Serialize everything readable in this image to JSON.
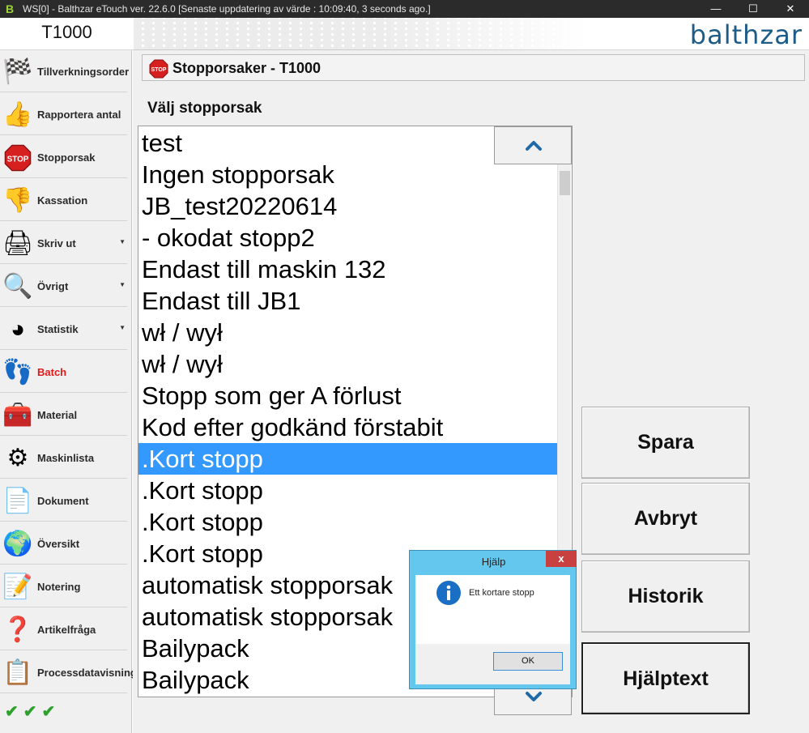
{
  "window": {
    "title": "WS[0] - Balthzar eTouch ver. 22.6.0  [Senaste uppdatering av värde : 10:09:40, 3 seconds ago.]",
    "app_icon_glyph": "B",
    "controls": {
      "minimize": "—",
      "maximize": "☐",
      "close": "✕"
    }
  },
  "header": {
    "machine": "T1000",
    "logo": "balthzar",
    "logo_color": "#1e5c88"
  },
  "sidebar": {
    "items": [
      {
        "label": "Tillverkningsorder",
        "icon": "checkered-flag-icon",
        "glyph": "🏁"
      },
      {
        "label": "Rapportera antal",
        "icon": "thumbs-up-icon",
        "glyph": "👍"
      },
      {
        "label": "Stopporsak",
        "icon": "stop-sign-icon",
        "glyph": "STOP"
      },
      {
        "label": "Kassation",
        "icon": "thumbs-down-icon",
        "glyph": "👎"
      },
      {
        "label": "Skriv ut",
        "icon": "printer-icon",
        "glyph": "🖨",
        "has_submenu": true
      },
      {
        "label": "Övrigt",
        "icon": "magnifier-icon",
        "glyph": "🔍",
        "has_submenu": true
      },
      {
        "label": "Statistik",
        "icon": "pie-chart-icon",
        "glyph": "◕",
        "has_submenu": true
      },
      {
        "label": "Batch",
        "icon": "footprints-icon",
        "glyph": "👣",
        "active": true
      },
      {
        "label": "Material",
        "icon": "toolbox-icon",
        "glyph": "🧰"
      },
      {
        "label": "Maskinlista",
        "icon": "gears-icon",
        "glyph": "⚙"
      },
      {
        "label": "Dokument",
        "icon": "document-icon",
        "glyph": "📄"
      },
      {
        "label": "Översikt",
        "icon": "globe-icon",
        "glyph": "🌍"
      },
      {
        "label": "Notering",
        "icon": "notepad-pencil-icon",
        "glyph": "📝"
      },
      {
        "label": "Artikelfråga",
        "icon": "question-icon",
        "glyph": "❓"
      },
      {
        "label": "Processdatavisning",
        "icon": "data-sheet-icon",
        "glyph": "📋"
      }
    ],
    "submenu_arrow": "▼",
    "status_checks": "✔✔✔",
    "active_color": "#e01a1a"
  },
  "panel": {
    "title": "Stopporsaker - T1000",
    "stop_icon_text": "STOP",
    "choose_label": "Välj stopporsak"
  },
  "reasons": {
    "selected_index": 10,
    "items": [
      "test",
      "Ingen stopporsak",
      "JB_test20220614",
      "- okodat stopp2",
      "Endast till maskin 132",
      "Endast till JB1",
      "wł / wył",
      "wł / wył",
      "Stopp som ger A förlust",
      "Kod efter godkänd förstabit",
      ".Kort stopp",
      ".Kort stopp",
      ".Kort stopp",
      ".Kort stopp",
      "automatisk stopporsak",
      "automatisk stopporsak",
      "Bailypack",
      "Bailypack"
    ],
    "selection_color": "#3399ff"
  },
  "actions": {
    "save": "Spara",
    "cancel": "Avbryt",
    "history": "Historik",
    "help_text": "Hjälptext"
  },
  "dialog": {
    "title": "Hjälp",
    "message": "Ett kortare stopp",
    "ok": "OK",
    "close": "x",
    "titlebar_color": "#64c8ee"
  }
}
